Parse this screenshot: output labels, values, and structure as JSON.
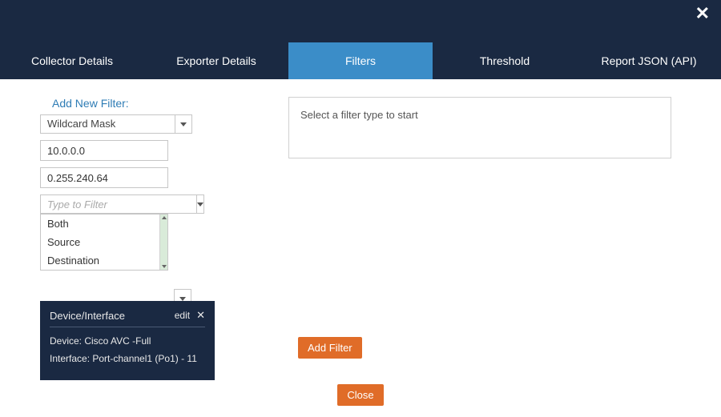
{
  "header": {},
  "tabs": [
    {
      "label": "Collector Details",
      "active": false
    },
    {
      "label": "Exporter Details",
      "active": false
    },
    {
      "label": "Filters",
      "active": true
    },
    {
      "label": "Threshold",
      "active": false
    },
    {
      "label": "Report JSON (API)",
      "active": false
    }
  ],
  "filterForm": {
    "title": "Add New Filter:",
    "maskSelect": "Wildcard Mask",
    "ipValue": "10.0.0.0",
    "maskValue": "0.255.240.64",
    "typePlaceholder": "Type to Filter",
    "options": [
      "Both",
      "Source",
      "Destination"
    ]
  },
  "message": "Select a filter type to start",
  "buttons": {
    "addFilter": "Add Filter",
    "close": "Close"
  },
  "card": {
    "title": "Device/Interface",
    "edit": "edit",
    "device": "Device: Cisco AVC -Full",
    "interface": "Interface: Port-channel1 (Po1) - 11"
  }
}
